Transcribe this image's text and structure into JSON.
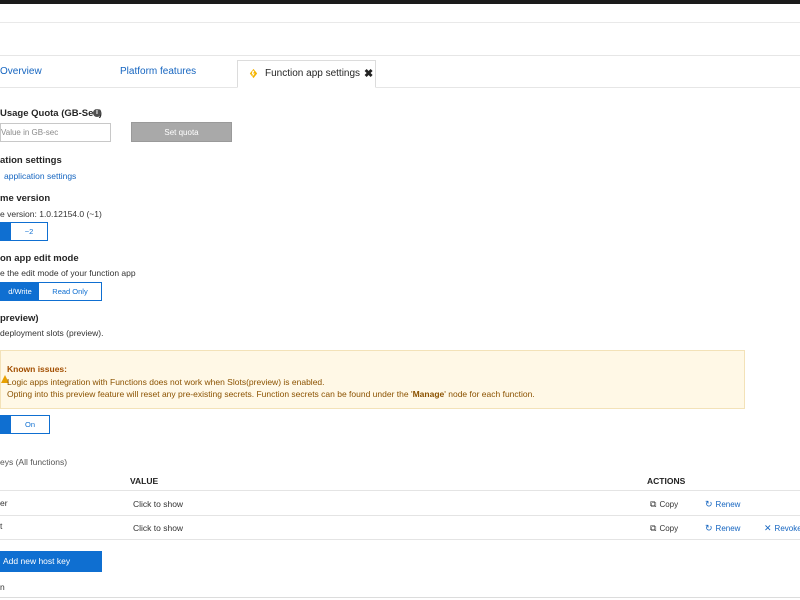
{
  "tabs": {
    "overview": "Overview",
    "platform_features": "Platform features",
    "function_app_settings": "Function app settings"
  },
  "quota": {
    "heading": "Usage Quota (GB-Sec)",
    "input_placeholder": "Value in GB-sec",
    "set_button": "Set quota"
  },
  "app_settings": {
    "heading": "ation settings",
    "link": "application settings"
  },
  "runtime": {
    "heading": "me version",
    "current": "e version: 1.0.12154.0 (~1)",
    "options": [
      "",
      "~2"
    ]
  },
  "edit_mode": {
    "heading": "on app edit mode",
    "description": "e the edit mode of your function app",
    "options": [
      "d/Write",
      "Read Only"
    ]
  },
  "slots": {
    "heading": "preview)",
    "description": "deployment slots (preview).",
    "options": [
      "",
      "On"
    ]
  },
  "warning": {
    "title": "Known issues:",
    "line1": "Logic apps integration with Functions does not work when Slots(preview) is enabled.",
    "line2_pre": "Opting into this preview feature will reset any pre-existing secrets. Function secrets can be found under the '",
    "line2_bold": "Manage",
    "line2_post": "' node for each function."
  },
  "host_keys": {
    "heading": "eys (All functions)",
    "columns": {
      "value": "VALUE",
      "actions": "ACTIONS"
    },
    "rows": [
      {
        "name": "er",
        "value": "Click to show",
        "copy": "Copy",
        "renew": "Renew",
        "revoke": ""
      },
      {
        "name": "t",
        "value": "Click to show",
        "copy": "Copy",
        "renew": "Renew",
        "revoke": "Revoke"
      }
    ],
    "add_button": "Add new host key"
  },
  "footer_fragment": "n",
  "colors": {
    "accent": "#0f6fd1",
    "link": "#1565c0",
    "warning_bg": "#fff8e6"
  }
}
